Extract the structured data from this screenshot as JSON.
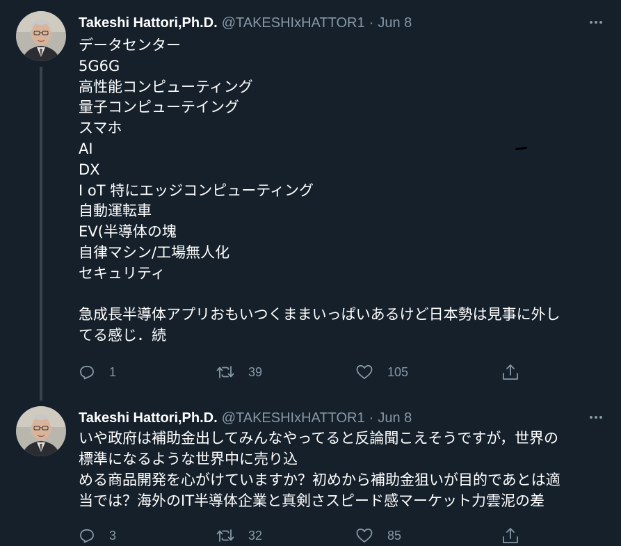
{
  "theme": {
    "background": "#15202b",
    "text": "#ffffff",
    "secondary_text": "#8899a6",
    "thread_line": "#38444d"
  },
  "tweets": [
    {
      "author_name": "Takeshi Hattori,Ph.D.",
      "handle": "@TAKESHIxHATTOR1",
      "separator": "·",
      "date": "Jun 8",
      "lines": [
        "データセンター",
        "5G6G",
        "高性能コンピューティング",
        "量子コンピューテイング",
        "スマホ",
        "AI",
        "DX",
        "I oT  特にエッジコンピューティング",
        "自動運転車",
        "EV(半導体の塊",
        "自律マシン/工場無人化",
        "セキュリティ",
        "",
        "急成長半導体アプリおもいつくままいっぱいあるけど日本勢は見事に外し",
        "てる感じ．続"
      ],
      "reply_count": "1",
      "retweet_count": "39",
      "like_count": "105"
    },
    {
      "author_name": "Takeshi Hattori,Ph.D.",
      "handle": "@TAKESHIxHATTOR1",
      "separator": "·",
      "date": "Jun 8",
      "lines": [
        "いや政府は補助金出してみんなやってると反論聞こえそうですが，世界の",
        "標準になるような世界中に売り込",
        "める商品開発を心がけていますか？初めから補助金狙いが目的であとは適",
        "当では？海外のIT半導体企業と真剣さスピード感マーケット力雲泥の差"
      ],
      "reply_count": "3",
      "retweet_count": "32",
      "like_count": "85"
    }
  ]
}
